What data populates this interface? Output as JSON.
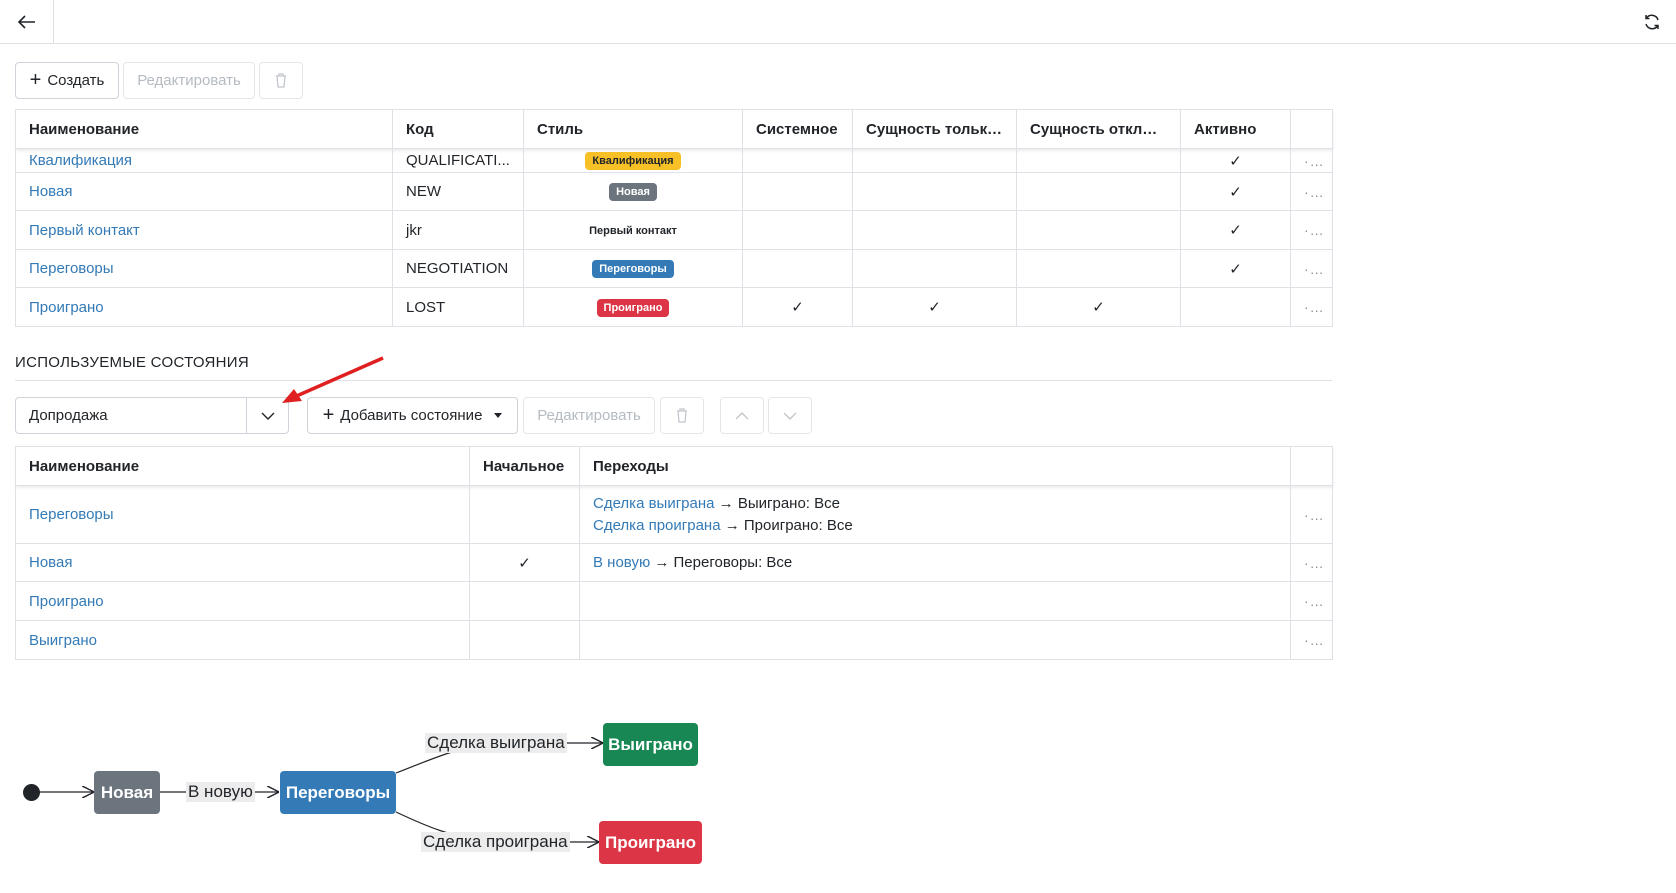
{
  "toolbar": {
    "create_label": "Создать",
    "edit_label": "Редактировать"
  },
  "states_table": {
    "headers": [
      "Наименование",
      "Код",
      "Стиль",
      "Системное",
      "Сущность только...",
      "Сущность отклю...",
      "Активно"
    ],
    "rows": [
      {
        "name": "Квалификация",
        "code": "QUALIFICATI...",
        "style_label": "Квалификация",
        "style_bg": "#f6c026",
        "style_fg": "#212529",
        "system": "",
        "only": "",
        "disabled": "",
        "active": "✓"
      },
      {
        "name": "Новая",
        "code": "NEW",
        "style_label": "Новая",
        "style_bg": "#6c757d",
        "style_fg": "#ffffff",
        "system": "",
        "only": "",
        "disabled": "",
        "active": "✓"
      },
      {
        "name": "Первый контакт",
        "code": "jkr",
        "style_label": "Первый контакт",
        "style_bg": "#ffffff",
        "style_fg": "#212529",
        "system": "",
        "only": "",
        "disabled": "",
        "active": "✓"
      },
      {
        "name": "Переговоры",
        "code": "NEGOTIATION",
        "style_label": "Переговоры",
        "style_bg": "#337ab7",
        "style_fg": "#ffffff",
        "system": "",
        "only": "",
        "disabled": "",
        "active": "✓"
      },
      {
        "name": "Проиграно",
        "code": "LOST",
        "style_label": "Проиграно",
        "style_bg": "#dc3545",
        "style_fg": "#ffffff",
        "system": "✓",
        "only": "✓",
        "disabled": "✓",
        "active": ""
      }
    ],
    "more": "···"
  },
  "used_states": {
    "title": "ИСПОЛЬЗУЕМЫЕ СОСТОЯНИЯ",
    "selected": "Допродажа",
    "add_label": "Добавить состояние",
    "edit_label": "Редактировать",
    "headers": [
      "Наименование",
      "Начальное",
      "Переходы"
    ],
    "rows": [
      {
        "name": "Переговоры",
        "initial": "",
        "transitions": [
          {
            "link": "Сделка выиграна",
            "text": " → Выиграно: Все"
          },
          {
            "link": "Сделка проиграна",
            "text": " → Проиграно: Все"
          }
        ]
      },
      {
        "name": "Новая",
        "initial": "✓",
        "transitions": [
          {
            "link": "В новую",
            "text": " → Переговоры: Все"
          }
        ]
      },
      {
        "name": "Проиграно",
        "initial": "",
        "transitions": []
      },
      {
        "name": "Выиграно",
        "initial": "",
        "transitions": []
      }
    ]
  },
  "diagram": {
    "nodes": {
      "new": "Новая",
      "negotiation": "Переговоры",
      "won": "Выиграно",
      "lost": "Проиграно"
    },
    "edges": {
      "to_negotiation": "В новую",
      "won": "Сделка выиграна",
      "lost": "Сделка проиграна"
    },
    "colors": {
      "new": "#6c757d",
      "negotiation": "#337ab7",
      "won": "#198754",
      "lost": "#dc3545"
    }
  }
}
